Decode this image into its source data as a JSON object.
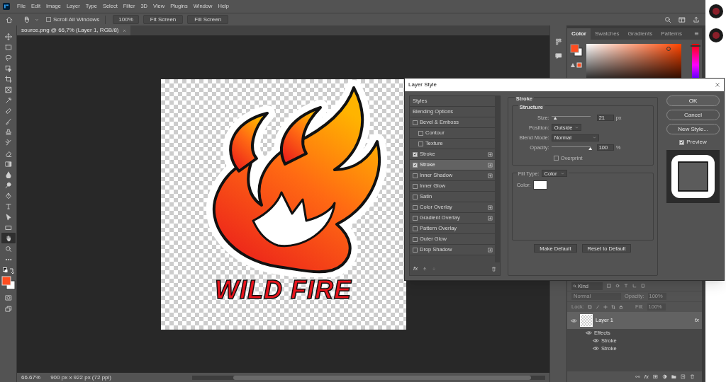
{
  "menu": [
    "File",
    "Edit",
    "Image",
    "Layer",
    "Type",
    "Select",
    "Filter",
    "3D",
    "View",
    "Plugins",
    "Window",
    "Help"
  ],
  "options_bar": {
    "scroll_all_windows": {
      "label": "Scroll All Windows",
      "checked": false
    },
    "buttons": [
      "100%",
      "Fit Screen",
      "Fill Screen"
    ]
  },
  "document_tab": {
    "title": "source.png @ 66,7% (Layer 1, RGB/8)"
  },
  "tools": [
    {
      "selected": false
    },
    {
      "selected": false
    },
    {
      "selected": false
    },
    {
      "selected": false
    },
    {
      "selected": false
    },
    {
      "selected": false
    },
    {
      "selected": false
    },
    {
      "selected": false
    },
    {
      "selected": false
    },
    {
      "selected": false
    },
    {
      "selected": false
    },
    {
      "selected": false
    },
    {
      "selected": false
    },
    {
      "selected": false
    },
    {
      "selected": false
    },
    {
      "selected": false
    },
    {
      "selected": false
    },
    {
      "selected": false
    },
    {
      "selected": false
    },
    {
      "selected": true
    },
    {
      "selected": false
    },
    {
      "selected": false
    }
  ],
  "canvas": {
    "artwork_text": "WILD FIRE"
  },
  "status_bar": {
    "zoom": "66.67%",
    "info": "900 px x 922 px (72 ppi)"
  },
  "color_panel": {
    "tabs": [
      {
        "label": "Color",
        "selected": true
      },
      {
        "label": "Swatches",
        "selected": false
      },
      {
        "label": "Gradients",
        "selected": false
      },
      {
        "label": "Patterns",
        "selected": false
      }
    ],
    "hue_slider": {
      "level": 0.97
    }
  },
  "layers_panel": {
    "filter_placeholder": "Kind",
    "blend_mode": "Normal",
    "opacity_label": "Opacity:",
    "opacity": "100%",
    "lock_label": "Lock:",
    "fill_label": "Fill:",
    "fill": "100%",
    "fx": "fx",
    "layers": [
      {
        "name": "Layer 1",
        "selected": true,
        "visible": true,
        "fx": "fx",
        "effects_label": "Effects",
        "effects": [
          {
            "name": "Stroke",
            "visible": true
          },
          {
            "name": "Stroke",
            "visible": true
          }
        ]
      }
    ]
  },
  "dialog": {
    "title": "Layer Style",
    "styles": [
      {
        "label": "Styles",
        "kind": "header",
        "selected": false
      },
      {
        "label": "Blending Options",
        "kind": "header",
        "selected": false
      },
      {
        "label": "Bevel & Emboss",
        "kind": "check",
        "checked": false,
        "selected": false,
        "add": false
      },
      {
        "label": "Contour",
        "kind": "subcheck",
        "checked": false,
        "selected": false
      },
      {
        "label": "Texture",
        "kind": "subcheck",
        "checked": false,
        "selected": false
      },
      {
        "label": "Stroke",
        "kind": "check",
        "checked": true,
        "selected": false,
        "add": true
      },
      {
        "label": "Stroke",
        "kind": "check",
        "checked": true,
        "selected": true,
        "add": true
      },
      {
        "label": "Inner Shadow",
        "kind": "check",
        "checked": false,
        "selected": false,
        "add": true
      },
      {
        "label": "Inner Glow",
        "kind": "check",
        "checked": false,
        "selected": false,
        "add": false
      },
      {
        "label": "Satin",
        "kind": "check",
        "checked": false,
        "selected": false,
        "add": false
      },
      {
        "label": "Color Overlay",
        "kind": "check",
        "checked": false,
        "selected": false,
        "add": true
      },
      {
        "label": "Gradient Overlay",
        "kind": "check",
        "checked": false,
        "selected": false,
        "add": true
      },
      {
        "label": "Pattern Overlay",
        "kind": "check",
        "checked": false,
        "selected": false,
        "add": false
      },
      {
        "label": "Outer Glow",
        "kind": "check",
        "checked": false,
        "selected": false,
        "add": false
      },
      {
        "label": "Drop Shadow",
        "kind": "check",
        "checked": false,
        "selected": false,
        "add": true
      }
    ],
    "fx": "fx",
    "section_title": "Stroke",
    "structure_title": "Structure",
    "size": {
      "label": "Size:",
      "level": 0.1,
      "value": "21",
      "unit": "px"
    },
    "position": {
      "label": "Position:",
      "value": "Outside"
    },
    "blend_mode": {
      "label": "Blend Mode:",
      "value": "Normal"
    },
    "opacity": {
      "label": "Opacity:",
      "level": 1.0,
      "value": "100",
      "unit": "%"
    },
    "overprint": {
      "label": "Overprint",
      "checked": false
    },
    "fill_type": {
      "label": "Fill Type:",
      "value": "Color"
    },
    "color": {
      "label": "Color:",
      "color": "#ffffff"
    },
    "make_default": "Make Default",
    "reset_default": "Reset to Default",
    "buttons": [
      "OK",
      "Cancel",
      "New Style..."
    ],
    "preview": {
      "label": "Preview",
      "checked": true
    }
  }
}
